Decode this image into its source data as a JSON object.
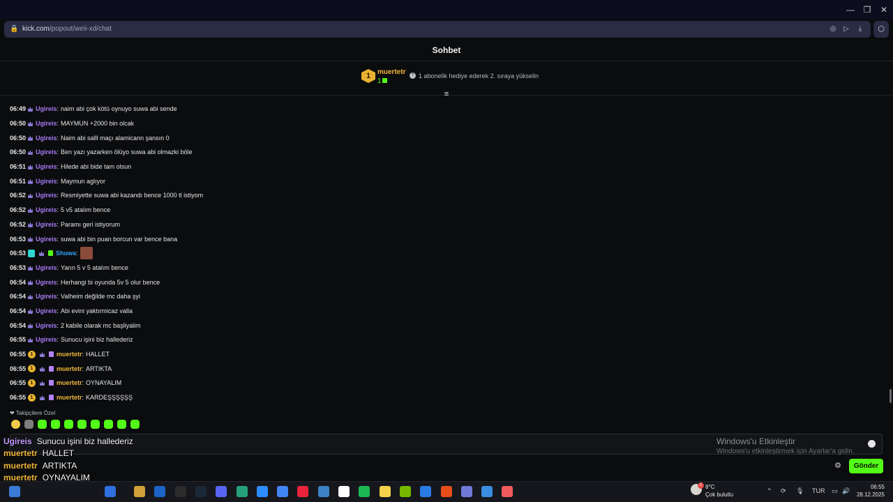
{
  "browser": {
    "url_host": "kick.com",
    "url_path": "/popout/weii-xd/chat",
    "window_controls": [
      "—",
      "❐",
      "✕"
    ]
  },
  "chat": {
    "title": "Sohbet",
    "leaderboard": {
      "rank": "1",
      "user": "muertetr",
      "count": "1",
      "hint": "1 abonelik hediye ederek 2. sıraya yükselin"
    },
    "messages": [
      {
        "time": "06:49",
        "badges": [
          "sub"
        ],
        "user": "Ugireis",
        "color": "#a87bf5",
        "text": "naim abi çok kötü oynuyo suwa abi sende"
      },
      {
        "time": "06:50",
        "badges": [
          "sub"
        ],
        "user": "Ugireis",
        "color": "#a87bf5",
        "text": "MAYMUN +2000 bin olcak"
      },
      {
        "time": "06:50",
        "badges": [
          "sub"
        ],
        "user": "Ugireis",
        "color": "#a87bf5",
        "text": "Naim abi salll maçı alamicann şansın 0"
      },
      {
        "time": "06:50",
        "badges": [
          "sub"
        ],
        "user": "Ugireis",
        "color": "#a87bf5",
        "text": "Ben yazı yazarken ölüyo suwa abi olmazki böle"
      },
      {
        "time": "06:51",
        "badges": [
          "sub"
        ],
        "user": "Ugireis",
        "color": "#a87bf5",
        "text": "Hilede abi bide tam olsun"
      },
      {
        "time": "06:51",
        "badges": [
          "sub"
        ],
        "user": "Ugireis",
        "color": "#a87bf5",
        "text": "Maymun aglıyor"
      },
      {
        "time": "06:52",
        "badges": [
          "sub"
        ],
        "user": "Ugireis",
        "color": "#a87bf5",
        "text": "Resmiyette suwa abi kazandı bence 1000 tl istiyom"
      },
      {
        "time": "06:52",
        "badges": [
          "sub"
        ],
        "user": "Ugireis",
        "color": "#a87bf5",
        "text": "5 v5 atalım bence"
      },
      {
        "time": "06:52",
        "badges": [
          "sub"
        ],
        "user": "Ugireis",
        "color": "#a87bf5",
        "text": "Paramı geri istiyorum"
      },
      {
        "time": "06:53",
        "badges": [
          "sub"
        ],
        "user": "Ugireis",
        "color": "#a87bf5",
        "text": "suwa abi bin puan borcun var bence bana"
      },
      {
        "time": "06:53",
        "badges": [
          "verified",
          "sub",
          "gift-green"
        ],
        "user": "Shuwa",
        "color": "#2f9ff8",
        "text": "",
        "emote": true
      },
      {
        "time": "06:53",
        "badges": [
          "sub"
        ],
        "user": "Ugireis",
        "color": "#a87bf5",
        "text": "Yarın 5 v 5 atalım bence"
      },
      {
        "time": "06:54",
        "badges": [
          "sub"
        ],
        "user": "Ugireis",
        "color": "#a87bf5",
        "text": "Herhangi bi oyunda 5v 5 olur bence"
      },
      {
        "time": "06:54",
        "badges": [
          "sub"
        ],
        "user": "Ugireis",
        "color": "#a87bf5",
        "text": "Valheim değilde mc daha şyi"
      },
      {
        "time": "06:54",
        "badges": [
          "sub"
        ],
        "user": "Ugireis",
        "color": "#a87bf5",
        "text": "Abi evini yaktırmicaz valla"
      },
      {
        "time": "06:54",
        "badges": [
          "sub"
        ],
        "user": "Ugireis",
        "color": "#a87bf5",
        "text": "2 kabile olarak mc başliyalim"
      },
      {
        "time": "06:55",
        "badges": [
          "sub"
        ],
        "user": "Ugireis",
        "color": "#a87bf5",
        "text": "Sunucu işini biz hallederiz"
      },
      {
        "time": "06:55",
        "badges": [
          "gold",
          "sub",
          "gift"
        ],
        "user": "muertetr",
        "color": "#f0b63a",
        "text": "HALLET"
      },
      {
        "time": "06:55",
        "badges": [
          "gold",
          "sub",
          "gift"
        ],
        "user": "muertetr",
        "color": "#f0b63a",
        "text": "ARTIKTA"
      },
      {
        "time": "06:55",
        "badges": [
          "gold",
          "sub",
          "gift"
        ],
        "user": "muertetr",
        "color": "#f0b63a",
        "text": "OYNAYALIM"
      },
      {
        "time": "06:55",
        "badges": [
          "gold",
          "sub",
          "gift"
        ],
        "user": "muertetr",
        "color": "#f0b63a",
        "text": "KARDEŞŞŞŞŞŞ"
      }
    ],
    "followers_label": "❤ Takipçilere Özel",
    "send_label": "Gönder",
    "gold_badge_label": "1"
  },
  "watermark": {
    "line1": "Windows'u Etkinleştir",
    "line2": "Windows'u etkinleştirmek için Ayarlar'a gidin."
  },
  "overlay": [
    {
      "user": "Ugireis",
      "color": "#c49cff",
      "text": "Sunucu işini biz hallederiz"
    },
    {
      "user": "muertetr",
      "color": "#f0b63a",
      "text": "HALLET"
    },
    {
      "user": "muertetr",
      "color": "#f0b63a",
      "text": "ARTIKTA"
    },
    {
      "user": "muertetr",
      "color": "#f0b63a",
      "text": "OYNAYALIM"
    },
    {
      "user": "muertetr",
      "color": "#f0b63a",
      "text": "KARDEŞŞŞŞŞŞ"
    }
  ],
  "taskbar": {
    "weather_badge": "2",
    "temp": "8°C",
    "condition": "Çok bulutlu",
    "lang": "TUR",
    "time": "06:55",
    "date": "28.12.2025",
    "app_colors": [
      "#3a7bd5",
      "#2f6fe0",
      "#d2a038",
      "#1b63c4",
      "#2b2b2b",
      "#1b2838",
      "#5865f2",
      "#27a07a",
      "#2d8cff",
      "#4285f4",
      "#e8243c",
      "#3b82c4",
      "#ffffff",
      "#1db954",
      "#f6d34a",
      "#76b900",
      "#2a7be4",
      "#e84d1c",
      "#6f7ad8",
      "#3a8de0",
      "#f05a5a"
    ]
  }
}
